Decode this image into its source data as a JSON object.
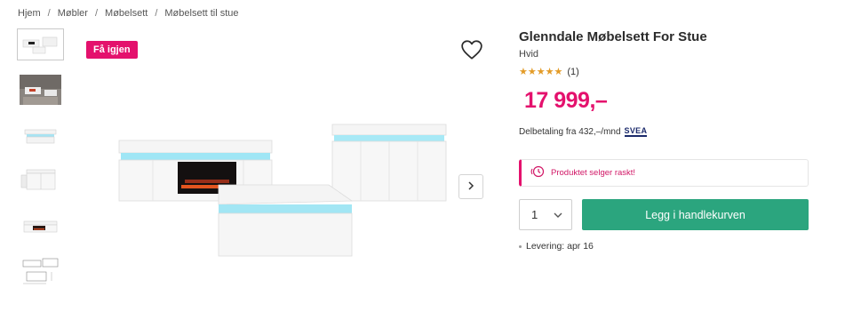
{
  "breadcrumb": {
    "items": [
      "Hjem",
      "Møbler",
      "Møbelsett",
      "Møbelsett til stue"
    ],
    "separator": "/"
  },
  "gallery": {
    "thumbnails": [
      {
        "name": "product-thumbnail-front",
        "active": true
      },
      {
        "name": "product-thumbnail-room",
        "active": false
      },
      {
        "name": "product-thumbnail-coffee-table",
        "active": false
      },
      {
        "name": "product-thumbnail-sideboard-open",
        "active": false
      },
      {
        "name": "product-thumbnail-tv-bench",
        "active": false
      },
      {
        "name": "product-thumbnail-drawing",
        "active": false
      }
    ],
    "badge": "Få igjen",
    "favorite_icon": "heart-icon",
    "next_icon": "chevron-right-icon"
  },
  "product": {
    "title": "Glenndale Møbelsett For Stue",
    "variant": "Hvid",
    "rating": {
      "stars": "★★★★★",
      "value": 5,
      "count": "(1)"
    },
    "price": "17 999,–",
    "installment": {
      "text": "Delbetaling fra 432,–/mnd",
      "provider": "SVEA"
    },
    "alert": {
      "icon": "clock-icon",
      "text": "Produktet selger raskt!"
    },
    "quantity": {
      "value": "1",
      "icon": "chevron-down-icon"
    },
    "add_to_cart": "Legg i handlekurven",
    "delivery": "Levering: apr 16"
  },
  "colors": {
    "brand_pink": "#e4116d",
    "cta_green": "#2ba57e",
    "star_orange": "#e39b27"
  }
}
